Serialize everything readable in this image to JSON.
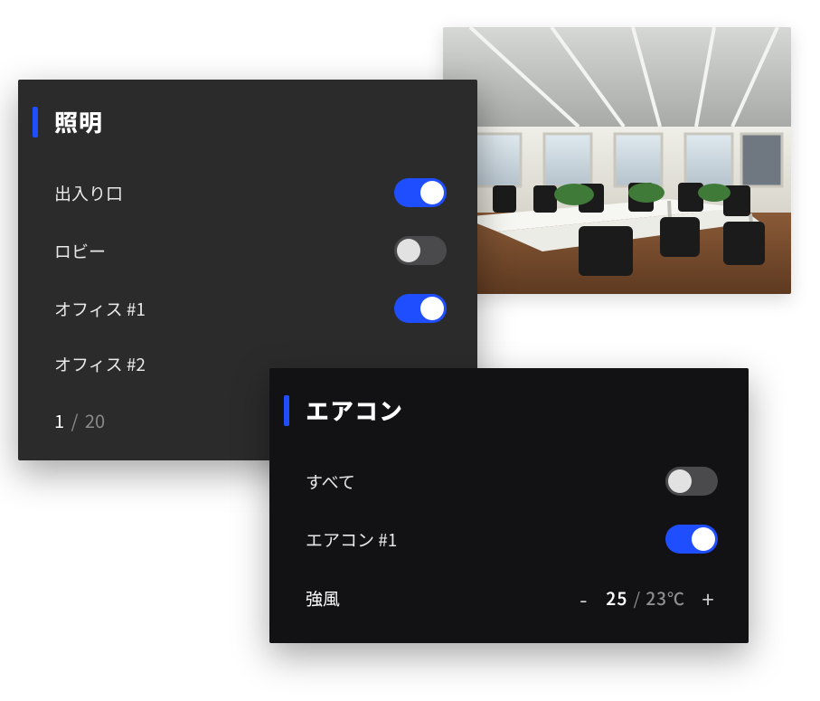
{
  "lighting": {
    "title": "照明",
    "items": [
      {
        "label": "出入り口",
        "on": true
      },
      {
        "label": "ロビー",
        "on": false
      },
      {
        "label": "オフィス #1",
        "on": true
      },
      {
        "label": "オフィス #2",
        "on": null
      }
    ],
    "page": {
      "current": "1",
      "sep": "/",
      "total": "20"
    }
  },
  "ac": {
    "title": "エアコン",
    "items": [
      {
        "label": "すべて",
        "on": false
      },
      {
        "label": "エアコン #1",
        "on": true
      }
    ],
    "fan": {
      "label": "強風",
      "minus": "-",
      "plus": "+",
      "set": "25",
      "sep": "/",
      "ambient": "23℃"
    }
  }
}
